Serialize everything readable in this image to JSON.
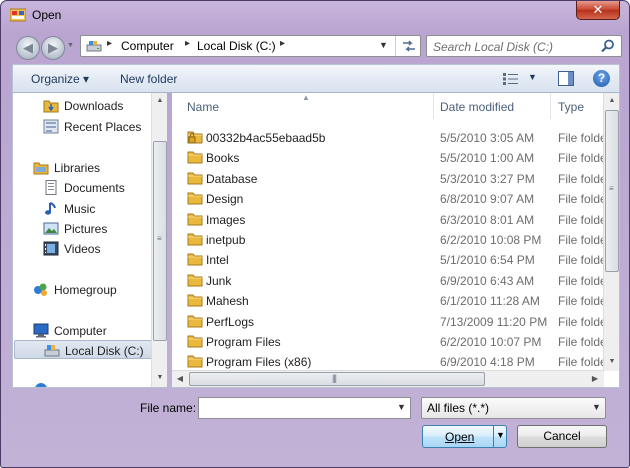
{
  "window": {
    "title": "Open",
    "close_label": "✕"
  },
  "address": {
    "crumbs": [
      "Computer",
      "Local Disk (C:)"
    ],
    "search_placeholder": "Search Local Disk (C:)"
  },
  "toolbar": {
    "organize_label": "Organize ▾",
    "new_folder_label": "New folder",
    "help_label": "?"
  },
  "nav": {
    "items": [
      {
        "label": "Downloads",
        "icon": "downloads-icon"
      },
      {
        "label": "Recent Places",
        "icon": "recent-places-icon"
      },
      {
        "label": "Libraries",
        "icon": "libraries-icon"
      },
      {
        "label": "Documents",
        "icon": "documents-icon"
      },
      {
        "label": "Music",
        "icon": "music-icon"
      },
      {
        "label": "Pictures",
        "icon": "pictures-icon"
      },
      {
        "label": "Videos",
        "icon": "videos-icon"
      },
      {
        "label": "Homegroup",
        "icon": "homegroup-icon"
      },
      {
        "label": "Computer",
        "icon": "computer-icon"
      },
      {
        "label": "Local Disk (C:)",
        "icon": "drive-icon",
        "selected": true
      }
    ]
  },
  "files": {
    "columns": [
      "Name",
      "Date modified",
      "Type"
    ],
    "rows": [
      {
        "name": "00332b4ac55ebaad5b",
        "date": "5/5/2010 3:05 AM",
        "type": "File folde",
        "locked": true
      },
      {
        "name": "Books",
        "date": "5/5/2010 1:00 AM",
        "type": "File folde"
      },
      {
        "name": "Database",
        "date": "5/3/2010 3:27 PM",
        "type": "File folde"
      },
      {
        "name": "Design",
        "date": "6/8/2010 9:07 AM",
        "type": "File folde"
      },
      {
        "name": "Images",
        "date": "6/3/2010 8:01 AM",
        "type": "File folde"
      },
      {
        "name": "inetpub",
        "date": "6/2/2010 10:08 PM",
        "type": "File folde"
      },
      {
        "name": "Intel",
        "date": "5/1/2010 6:54 PM",
        "type": "File folde"
      },
      {
        "name": "Junk",
        "date": "6/9/2010 6:43 AM",
        "type": "File folde"
      },
      {
        "name": "Mahesh",
        "date": "6/1/2010 11:28 AM",
        "type": "File folde"
      },
      {
        "name": "PerfLogs",
        "date": "7/13/2009 11:20 PM",
        "type": "File folde"
      },
      {
        "name": "Program Files",
        "date": "6/2/2010 10:07 PM",
        "type": "File folde"
      },
      {
        "name": "Program Files (x86)",
        "date": "6/9/2010 4:18 PM",
        "type": "File folde"
      }
    ]
  },
  "bottom": {
    "file_name_label": "File name:",
    "file_name_value": "",
    "filter_value": "All files (*.*)",
    "open_label": "Open",
    "cancel_label": "Cancel"
  },
  "colors": {
    "folder": "#e8b93c",
    "accent": "#3c7fb1"
  }
}
